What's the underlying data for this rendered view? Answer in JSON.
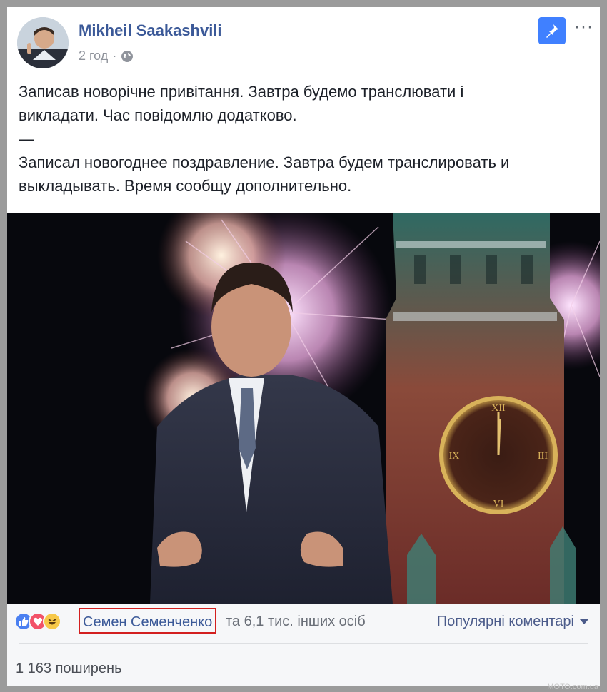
{
  "post": {
    "author": "Mikheil Saakashvili",
    "time": "2 год",
    "separator": "·",
    "text_lines": [
      "Записав новорічне привітання. Завтра будемо транслювати і",
      "викладати. Час повідомлю додатково.",
      "—",
      "Записал новогоднее поздравление. Завтра будем транслировать и",
      "выкладывать. Время сообщу дополнительно."
    ],
    "actions": {
      "more": "···"
    }
  },
  "reactions": {
    "icons": [
      "like-icon",
      "love-icon",
      "haha-icon"
    ],
    "highlighted_name": "Семен Семенченко",
    "others_text": "та 6,1 тис. інших осіб",
    "sort_label": "Популярні коментарі"
  },
  "shares": {
    "label": "1 163 поширень"
  },
  "watermark": "МОТО.com.ua",
  "colors": {
    "accent": "#3b5998",
    "highlight_border": "#d31f1f",
    "pin_button": "#4080ff"
  }
}
